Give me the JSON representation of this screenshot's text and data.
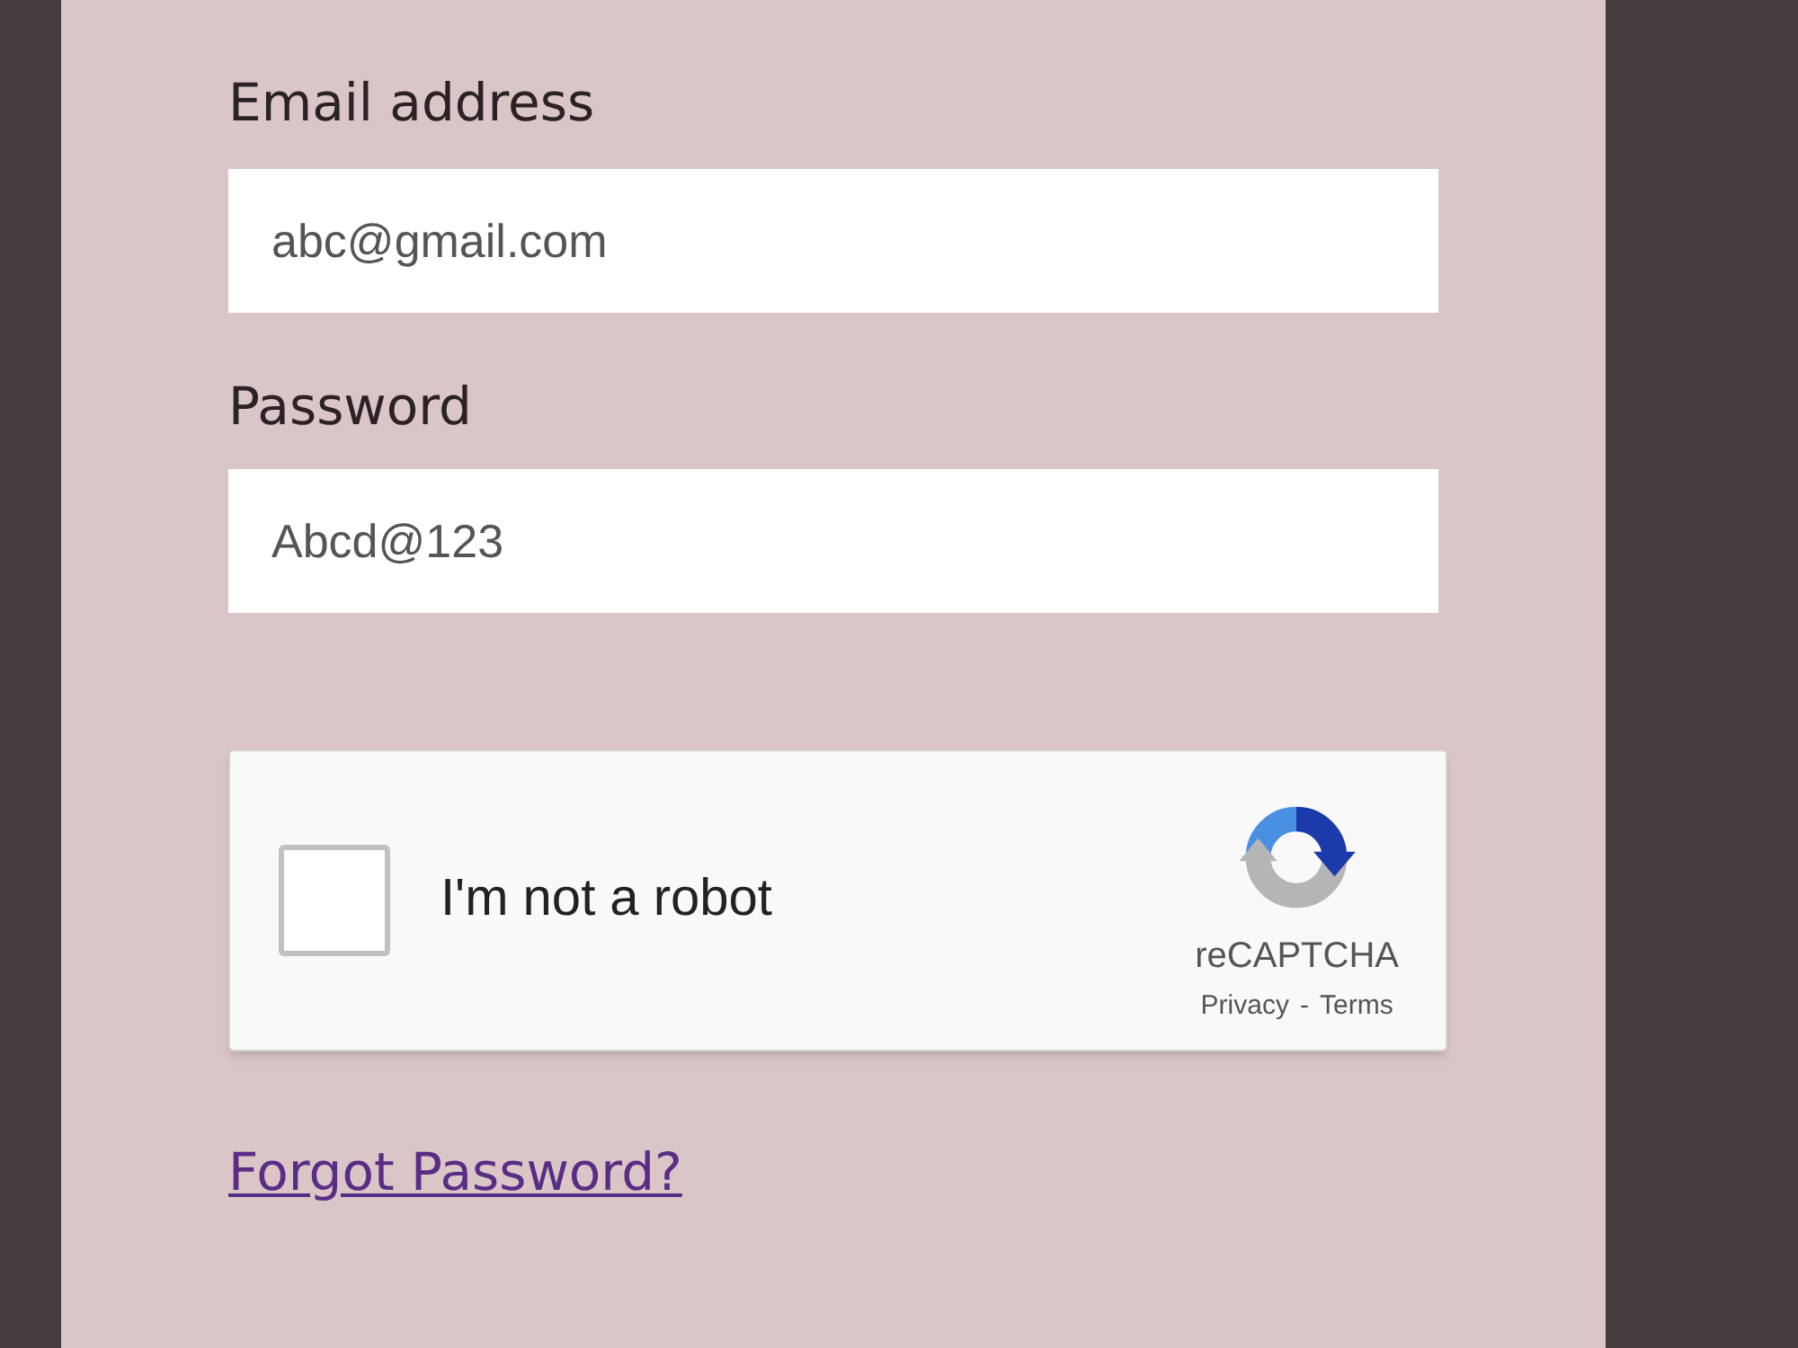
{
  "form": {
    "fields": [
      {
        "label": "Email address",
        "value": "abc@gmail.com"
      },
      {
        "label": "Password",
        "value": "Abcd@123"
      }
    ],
    "captcha": {
      "checked": false,
      "label": "I'm not a robot",
      "brand": "reCAPTCHA",
      "links": [
        "Privacy",
        "Terms"
      ],
      "separator": "-"
    },
    "forgot_link": "Forgot Password?"
  }
}
